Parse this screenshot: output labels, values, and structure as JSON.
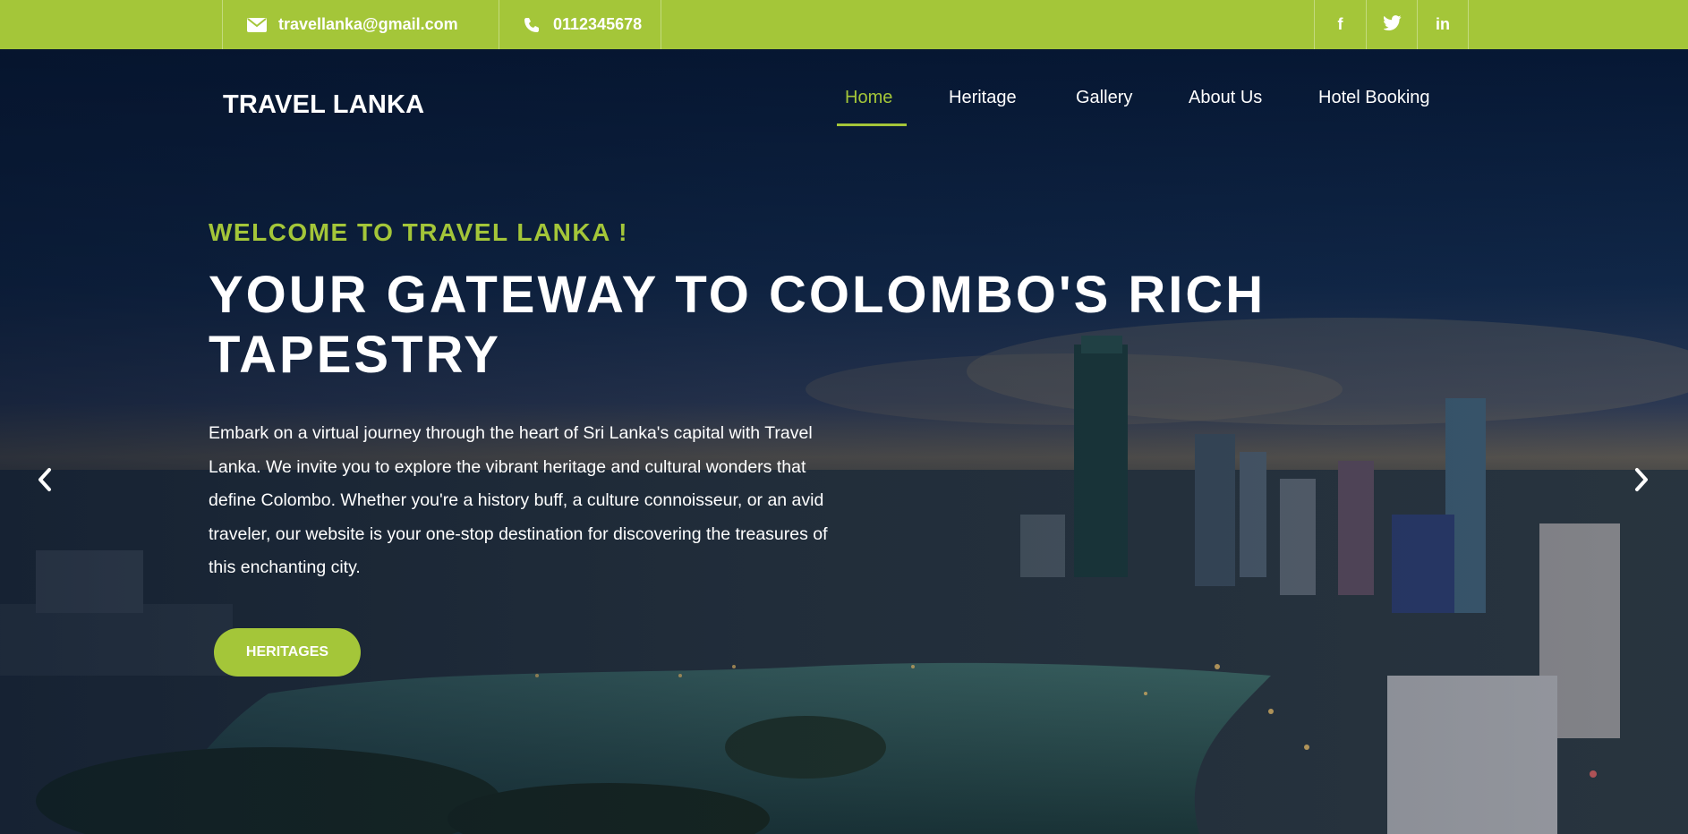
{
  "topbar": {
    "email": "travellanka@gmail.com",
    "phone": "0112345678",
    "social": [
      "f",
      "twitter-bird",
      "in"
    ]
  },
  "brand": "TRAVEL LANKA",
  "nav": {
    "items": [
      {
        "label": "Home",
        "active": true
      },
      {
        "label": "Heritage",
        "active": false
      },
      {
        "label": "Gallery",
        "active": false
      },
      {
        "label": "About Us",
        "active": false
      },
      {
        "label": "Hotel Booking",
        "active": false
      }
    ]
  },
  "hero": {
    "eyebrow": "WELCOME TO TRAVEL LANKA !",
    "title": "YOUR GATEWAY TO COLOMBO'S RICH TAPESTRY",
    "description": "Embark on a virtual journey through the heart of Sri Lanka's capital with Travel Lanka. We invite you to explore the vibrant heritage and cultural wonders that define Colombo. Whether you're a history buff, a culture connoisseur, or an avid traveler, our website is your one-stop destination for discovering the treasures of this enchanting city.",
    "button": "HERITAGES"
  },
  "icons": {
    "email": "envelope-icon",
    "phone": "phone-icon",
    "prev": "chevron-left-icon",
    "next": "chevron-right-icon"
  },
  "colors": {
    "accent": "#a4c639",
    "hero_dark": "#0b1c34"
  }
}
